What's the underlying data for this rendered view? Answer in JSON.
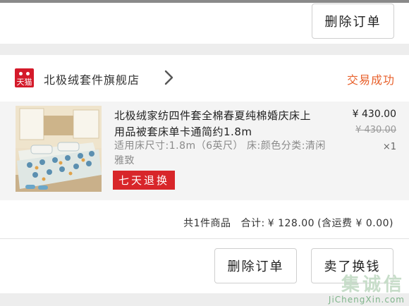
{
  "previous_order": {
    "delete_label": "删除订单"
  },
  "shop": {
    "logo_text": "天猫",
    "name": "北极绒套件旗舰店",
    "status": "交易成功"
  },
  "item": {
    "title": "北极绒家纺四件套全棉春夏纯棉婚庆床上用品被套床单卡通简约1.8m",
    "spec": "适用床尺寸:1.8m（6英尺） 床:颜色分类:清闲雅致",
    "badge": "七天退换",
    "price": "¥ 430.00",
    "original_price": "¥ 430.00",
    "quantity": "×1"
  },
  "summary": {
    "count_text": "共1件商品",
    "total_label": "合计:",
    "total_value": "¥ 128.00",
    "shipping_text": "(含运费 ¥ 0.00)"
  },
  "actions": {
    "delete_label": "删除订单",
    "sell_label": "卖了换钱"
  },
  "watermark": {
    "logo": "集诚信",
    "url": "JiChengXin.com"
  },
  "colors": {
    "accent": "#e8612c",
    "badge": "#d8262a",
    "logo": "#d41a2a"
  }
}
